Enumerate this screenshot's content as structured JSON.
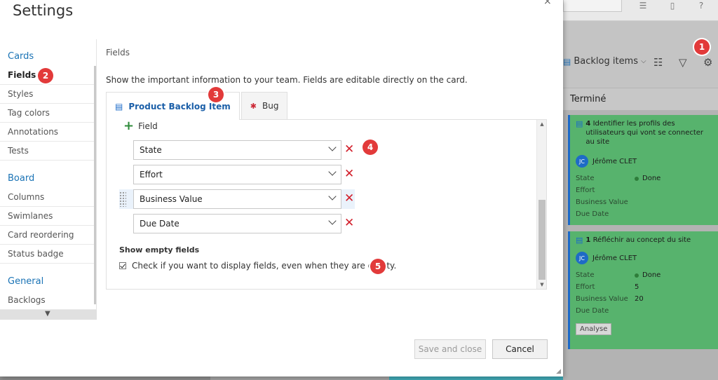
{
  "dialog": {
    "title": "Settings",
    "close_glyph": "×"
  },
  "sidebar": {
    "sections": [
      {
        "label": "Cards",
        "items": [
          "Fields",
          "Styles",
          "Tag colors",
          "Annotations",
          "Tests"
        ]
      },
      {
        "label": "Board",
        "items": [
          "Columns",
          "Swimlanes",
          "Card reordering",
          "Status badge"
        ]
      },
      {
        "label": "General",
        "items": [
          "Backlogs"
        ]
      }
    ],
    "active_item": "Fields",
    "scroll_down_glyph": "▼"
  },
  "content": {
    "breadcrumb": "Fields",
    "description": "Show the important information to your team. Fields are editable directly on the card.",
    "tabs": [
      {
        "label": "Product Backlog Item",
        "icon": "backlog-item-icon",
        "active": true
      },
      {
        "label": "Bug",
        "icon": "bug-icon",
        "active": false
      }
    ],
    "add_field_label": "Field",
    "fields": [
      "State",
      "Effort",
      "Business Value",
      "Due Date"
    ],
    "show_empty_title": "Show empty fields",
    "show_empty_checkbox_label": "Check if you want to display fields, even when they are empty.",
    "show_empty_checked": true
  },
  "footer": {
    "save_label": "Save and close",
    "cancel_label": "Cancel"
  },
  "badges": [
    "1",
    "2",
    "3",
    "4",
    "5"
  ],
  "board": {
    "backlog_selector": "Backlog items",
    "column_title": "Terminé",
    "cards": [
      {
        "id": "4",
        "title": "Identifier les profils des utilisateurs qui vont se connecter au site",
        "avatar": "JC",
        "user": "Jérôme CLET",
        "fields": [
          {
            "name": "State",
            "value": "Done"
          },
          {
            "name": "Effort",
            "value": ""
          },
          {
            "name": "Business Value",
            "value": ""
          },
          {
            "name": "Due Date",
            "value": ""
          }
        ]
      },
      {
        "id": "1",
        "title": "Réfléchir au concept du site",
        "avatar": "JC",
        "user": "Jérôme CLET",
        "fields": [
          {
            "name": "State",
            "value": "Done"
          },
          {
            "name": "Effort",
            "value": "5"
          },
          {
            "name": "Business Value",
            "value": "20"
          },
          {
            "name": "Due Date",
            "value": ""
          }
        ],
        "tag": "Analyse"
      }
    ]
  },
  "colors": {
    "accent": "#1a73b5",
    "card_green": "#57b36d",
    "badge_red": "#e23a3a",
    "remove_red": "#d21f2b"
  }
}
